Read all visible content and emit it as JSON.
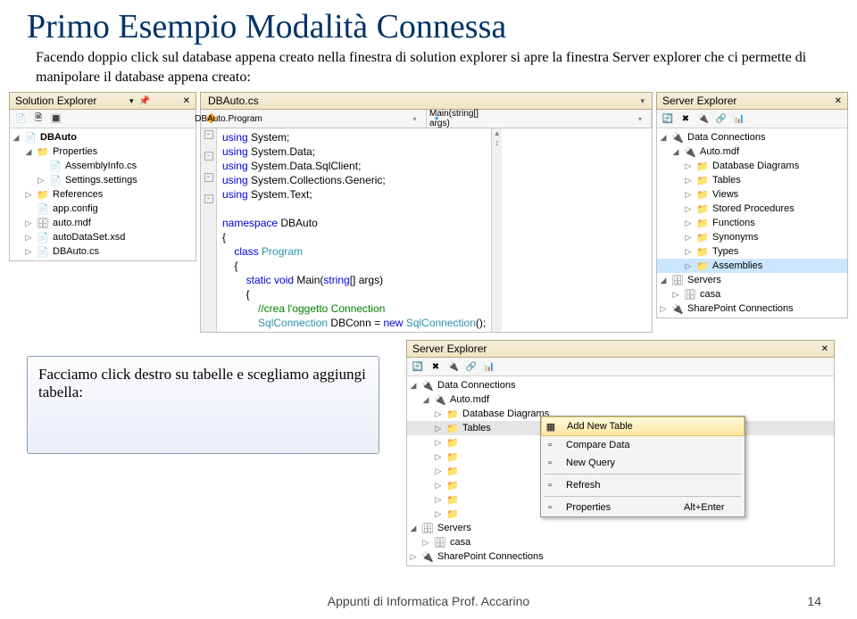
{
  "title": "Primo Esempio Modalità Connessa",
  "desc": "Facendo doppio click sul database appena creato nella finestra di solution explorer si apre la finestra Server explorer che ci permette di manipolare il database appena creato:",
  "solExp": {
    "header": "Solution Explorer",
    "items": [
      {
        "l": 1,
        "a": "o",
        "ic": "cs",
        "t": "DBAuto",
        "b": true
      },
      {
        "l": 2,
        "a": "o",
        "ic": "fold",
        "t": "Properties"
      },
      {
        "l": 3,
        "a": "n",
        "ic": "cs",
        "t": "AssemblyInfo.cs"
      },
      {
        "l": 3,
        "a": "c",
        "ic": "cfg",
        "t": "Settings.settings"
      },
      {
        "l": 2,
        "a": "c",
        "ic": "fold",
        "t": "References"
      },
      {
        "l": 2,
        "a": "n",
        "ic": "cfg",
        "t": "app.config"
      },
      {
        "l": 2,
        "a": "c",
        "ic": "db",
        "t": "auto.mdf"
      },
      {
        "l": 2,
        "a": "c",
        "ic": "xsd",
        "t": "autoDataSet.xsd"
      },
      {
        "l": 2,
        "a": "c",
        "ic": "cs",
        "t": "DBAuto.cs"
      }
    ]
  },
  "editor": {
    "tab": "DBAuto.cs",
    "crumbL": "DBAuto.Program",
    "crumbR": "Main(string[] args)"
  },
  "svExp": {
    "header": "Server Explorer",
    "items": [
      {
        "l": 1,
        "a": "o",
        "ic": "conn",
        "t": "Data Connections"
      },
      {
        "l": 2,
        "a": "o",
        "ic": "conn",
        "t": "Auto.mdf"
      },
      {
        "l": 3,
        "a": "c",
        "ic": "fold",
        "t": "Database Diagrams"
      },
      {
        "l": 3,
        "a": "c",
        "ic": "fold",
        "t": "Tables"
      },
      {
        "l": 3,
        "a": "c",
        "ic": "fold",
        "t": "Views"
      },
      {
        "l": 3,
        "a": "c",
        "ic": "fold",
        "t": "Stored Procedures"
      },
      {
        "l": 3,
        "a": "c",
        "ic": "fold",
        "t": "Functions"
      },
      {
        "l": 3,
        "a": "c",
        "ic": "fold",
        "t": "Synonyms"
      },
      {
        "l": 3,
        "a": "c",
        "ic": "fold",
        "t": "Types"
      },
      {
        "l": 3,
        "a": "c",
        "ic": "fold",
        "t": "Assemblies",
        "hi": true
      },
      {
        "l": 1,
        "a": "o",
        "ic": "db",
        "t": "Servers"
      },
      {
        "l": 2,
        "a": "c",
        "ic": "db",
        "t": "casa"
      },
      {
        "l": 1,
        "a": "c",
        "ic": "conn",
        "t": "SharePoint Connections"
      }
    ]
  },
  "note": "Facciamo click destro su tabelle e scegliamo aggiungi tabella:",
  "sv2": {
    "header": "Server Explorer",
    "items": [
      {
        "l": 1,
        "a": "o",
        "ic": "conn",
        "t": "Data Connections"
      },
      {
        "l": 2,
        "a": "o",
        "ic": "conn",
        "t": "Auto.mdf"
      },
      {
        "l": 3,
        "a": "c",
        "ic": "fold",
        "t": "Database Diagrams"
      },
      {
        "l": 3,
        "a": "c",
        "ic": "fold",
        "t": "Tables",
        "sel": true
      },
      {
        "l": 3,
        "a": "c",
        "ic": "fold",
        "t": ""
      },
      {
        "l": 3,
        "a": "c",
        "ic": "fold",
        "t": ""
      },
      {
        "l": 3,
        "a": "c",
        "ic": "fold",
        "t": ""
      },
      {
        "l": 3,
        "a": "c",
        "ic": "fold",
        "t": ""
      },
      {
        "l": 3,
        "a": "c",
        "ic": "fold",
        "t": ""
      },
      {
        "l": 3,
        "a": "c",
        "ic": "fold",
        "t": ""
      },
      {
        "l": 1,
        "a": "o",
        "ic": "db",
        "t": "Servers"
      },
      {
        "l": 2,
        "a": "c",
        "ic": "db",
        "t": "casa"
      },
      {
        "l": 1,
        "a": "c",
        "ic": "conn",
        "t": "SharePoint Connections"
      }
    ]
  },
  "ctx": [
    {
      "t": "Add New Table",
      "hi": true,
      "sc": ""
    },
    {
      "t": "Compare Data",
      "sc": ""
    },
    {
      "t": "New Query",
      "sc": ""
    },
    {
      "sep": true
    },
    {
      "t": "Refresh",
      "sc": ""
    },
    {
      "sep": true
    },
    {
      "t": "Properties",
      "sc": "Alt+Enter"
    }
  ],
  "footer": "Appunti di Informatica Prof. Accarino",
  "page": "14"
}
